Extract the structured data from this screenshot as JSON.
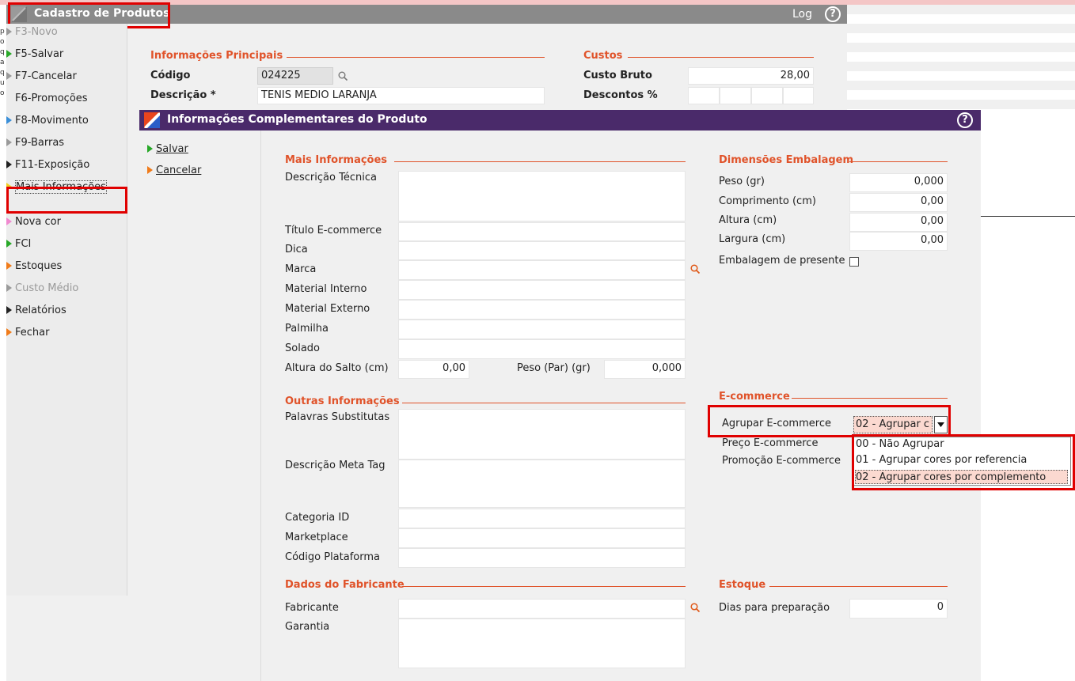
{
  "main_window": {
    "title": "Cadastro de Produtos",
    "log_label": "Log",
    "help_glyph": "?"
  },
  "left_edge_chars": [
    "p",
    "o",
    "q",
    "a",
    "q",
    "u",
    "o"
  ],
  "sidebar": {
    "items": [
      {
        "label": "F3-Novo",
        "icon": "triangle-gray",
        "disabled": true
      },
      {
        "label": "F5-Salvar",
        "icon": "triangle-green"
      },
      {
        "label": "F7-Cancelar",
        "icon": "triangle-gray"
      },
      {
        "label": "F6-Promoções",
        "icon": "none"
      },
      {
        "label": "F8-Movimento",
        "icon": "triangle-blue"
      },
      {
        "label": "F9-Barras",
        "icon": "triangle-gray"
      },
      {
        "label": "F11-Exposição",
        "icon": "triangle-black"
      },
      {
        "label": "Mais Informações",
        "icon": "triangle-yellow"
      },
      {
        "label": "Nova cor",
        "icon": "triangle-pink"
      },
      {
        "label": "FCI",
        "icon": "triangle-green"
      },
      {
        "label": "Estoques",
        "icon": "triangle-orange"
      },
      {
        "label": "Custo Médio",
        "icon": "triangle-gray",
        "disabled": true
      },
      {
        "label": "Relatórios",
        "icon": "triangle-black"
      },
      {
        "label": "Fechar",
        "icon": "triangle-orange"
      }
    ]
  },
  "principal": {
    "section_title": "Informações Principais",
    "codigo_label": "Código",
    "codigo_value": "024225",
    "descricao_label": "Descrição *",
    "descricao_value": "TENIS MEDIO LARANJA"
  },
  "custos": {
    "section_title": "Custos",
    "custo_bruto_label": "Custo Bruto",
    "custo_bruto_value": "28,00",
    "descontos_label": "Descontos %"
  },
  "dialog": {
    "title": "Informações Complementares do Produto",
    "help_glyph": "?",
    "menu": [
      {
        "label": "Salvar",
        "icon": "triangle-green"
      },
      {
        "label": "Cancelar",
        "icon": "triangle-orange"
      }
    ],
    "mais_info": {
      "section_title": "Mais Informações",
      "descricao_tecnica": "Descrição Técnica",
      "titulo_ecommerce": "Título E-commerce",
      "dica": "Dica",
      "marca": "Marca",
      "material_interno": "Material Interno",
      "material_externo": "Material Externo",
      "palmilha": "Palmilha",
      "solado": "Solado",
      "altura_salto_label": "Altura do Salto (cm)",
      "altura_salto_value": "0,00",
      "peso_par_label": "Peso (Par) (gr)",
      "peso_par_value": "0,000"
    },
    "dimensoes": {
      "section_title": "Dimensões Embalagem",
      "peso_label": "Peso (gr)",
      "peso_value": "0,000",
      "comprimento_label": "Comprimento (cm)",
      "comprimento_value": "0,00",
      "altura_label": "Altura (cm)",
      "altura_value": "0,00",
      "largura_label": "Largura (cm)",
      "largura_value": "0,00",
      "embalagem_presente_label": "Embalagem de presente"
    },
    "outras": {
      "section_title": "Outras Informações",
      "palavras_substitutas": "Palavras Substitutas",
      "descricao_meta_tag": "Descrição Meta Tag",
      "categoria_id": "Categoria ID",
      "marketplace": "Marketplace",
      "codigo_plataforma": "Código Plataforma"
    },
    "ecommerce": {
      "section_title": "E-commerce",
      "agrupar_label": "Agrupar E-commerce",
      "agrupar_value": "02 - Agrupar c",
      "preco_label": "Preço E-commerce",
      "promocao_label": "Promoção E-commerce",
      "options": [
        "00 - Não Agrupar",
        "01 - Agrupar cores por referencia",
        "02 - Agrupar cores por complemento"
      ]
    },
    "fabricante": {
      "section_title": "Dados do Fabricante",
      "fabricante_label": "Fabricante",
      "garantia_label": "Garantia"
    },
    "estoque": {
      "section_title": "Estoque",
      "dias_label": "Dias para preparação",
      "dias_value": "0"
    }
  },
  "colors": {
    "section_accent": "#e0532a",
    "dialog_titlebar": "#4a2a6a",
    "main_titlebar": "#8a8a8a",
    "highlight_box": "#e00000",
    "selected_option_bg": "#fbd9d0"
  }
}
